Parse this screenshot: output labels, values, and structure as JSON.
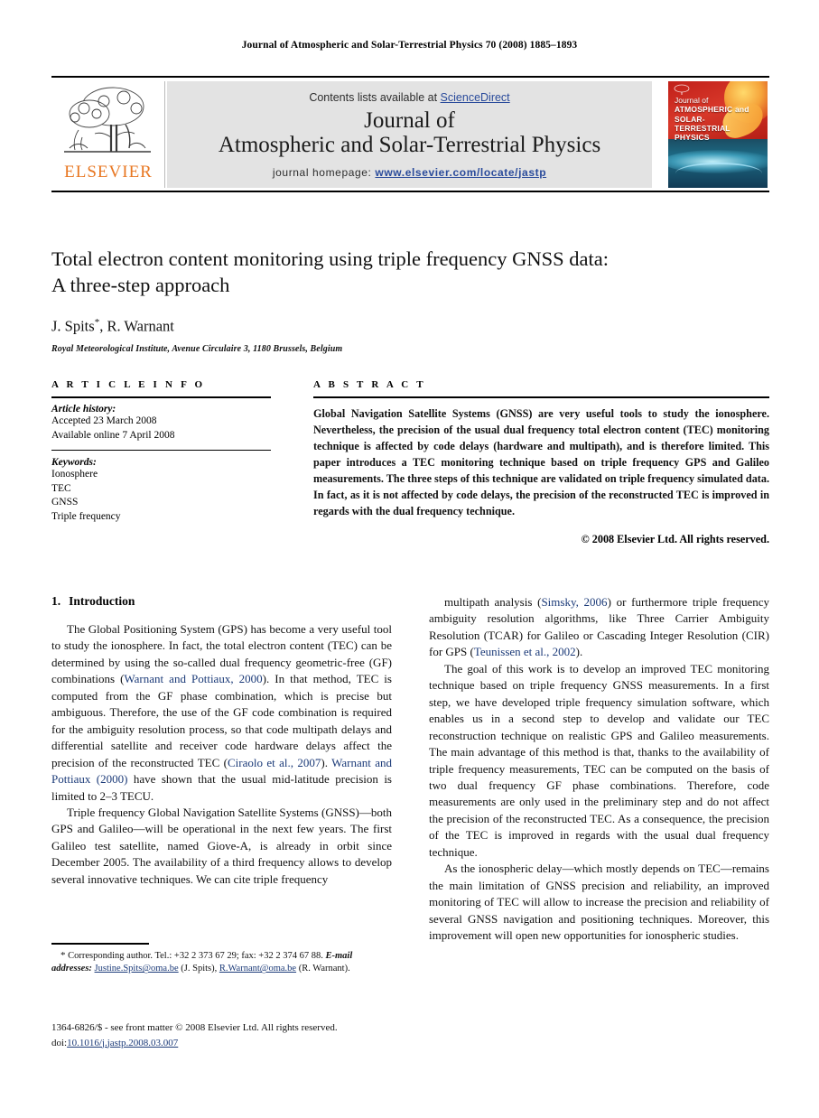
{
  "running_head": "Journal of Atmospheric and Solar-Terrestrial Physics 70 (2008) 1885–1893",
  "masthead": {
    "contents_prefix": "Contents lists available at ",
    "sciencedirect": "ScienceDirect",
    "journal_title_line1": "Journal of",
    "journal_title_line2": "Atmospheric and Solar-Terrestrial Physics",
    "homepage_label": "journal homepage: ",
    "homepage_url": "www.elsevier.com/locate/jastp",
    "publisher_wordmark": "ELSEVIER",
    "publisher_color": "#E87722",
    "link_color": "#2a4b9b",
    "panel_bg": "#e3e3e3",
    "cover": {
      "line1": "Journal of",
      "line2": "ATMOSPHERIC and",
      "line3": "SOLAR-TERRESTRIAL",
      "line4": "PHYSICS"
    }
  },
  "title_block": {
    "title_line1": "Total electron content monitoring using triple frequency GNSS data:",
    "title_line2": "A three-step approach",
    "authors": "J. Spits",
    "author_marker": "*",
    "authors_rest": ", R. Warnant",
    "affiliation": "Royal Meteorological Institute, Avenue Circulaire 3, 1180 Brussels, Belgium"
  },
  "article_info": {
    "heading": "A R T I C L E   I N F O",
    "history_label": "Article history:",
    "history_lines": [
      "Accepted 23 March 2008",
      "Available online 7 April 2008"
    ],
    "keywords_label": "Keywords:",
    "keywords": [
      "Ionosphere",
      "TEC",
      "GNSS",
      "Triple frequency"
    ]
  },
  "abstract": {
    "heading": "A B S T R A C T",
    "text": "Global Navigation Satellite Systems (GNSS) are very useful tools to study the ionosphere. Nevertheless, the precision of the usual dual frequency total electron content (TEC) monitoring technique is affected by code delays (hardware and multipath), and is therefore limited. This paper introduces a TEC monitoring technique based on triple frequency GPS and Galileo measurements. The three steps of this technique are validated on triple frequency simulated data. In fact, as it is not affected by code delays, the precision of the reconstructed TEC is improved in regards with the dual frequency technique.",
    "copyright": "© 2008 Elsevier Ltd. All rights reserved."
  },
  "body": {
    "section_number": "1.",
    "section_title": "Introduction",
    "left_paragraphs": [
      {
        "segments": [
          {
            "t": "The Global Positioning System (GPS) has become a very useful tool to study the ionosphere. In fact, the total electron content (TEC) can be determined by using the so-called dual frequency geometric-free (GF) combinations (",
            "cite": false
          },
          {
            "t": "Warnant and Pottiaux, 2000",
            "cite": true
          },
          {
            "t": "). In that method, TEC is computed from the GF phase combination, which is precise but ambiguous. Therefore, the use of the GF code combination is required for the ambiguity resolution process, so that code multipath delays and differential satellite and receiver code hardware delays affect the precision of the reconstructed TEC (",
            "cite": false
          },
          {
            "t": "Ciraolo et al., 2007",
            "cite": true
          },
          {
            "t": "). ",
            "cite": false
          },
          {
            "t": "Warnant and Pottiaux (2000)",
            "cite": true
          },
          {
            "t": " have shown that the usual mid-latitude precision is limited to 2–3 TECU.",
            "cite": false
          }
        ]
      },
      {
        "segments": [
          {
            "t": "Triple frequency Global Navigation Satellite Systems (GNSS)—both GPS and Galileo—will be operational in the next few years. The first Galileo test satellite, named Giove-A, is already in orbit since December 2005. The availability of a third frequency allows to develop several innovative techniques. We can cite triple frequency",
            "cite": false
          }
        ]
      }
    ],
    "right_paragraphs": [
      {
        "segments": [
          {
            "t": "multipath analysis (",
            "cite": false
          },
          {
            "t": "Simsky, 2006",
            "cite": true
          },
          {
            "t": ") or furthermore triple frequency ambiguity resolution algorithms, like Three Carrier Ambiguity Resolution (TCAR) for Galileo or Cascading Integer Resolution (CIR) for GPS (",
            "cite": false
          },
          {
            "t": "Teunissen et al., 2002",
            "cite": true
          },
          {
            "t": ").",
            "cite": false
          }
        ],
        "no_indent": false
      },
      {
        "segments": [
          {
            "t": "The goal of this work is to develop an improved TEC monitoring technique based on triple frequency GNSS measurements. In a first step, we have developed triple frequency simulation software, which enables us in a second step to develop and validate our TEC reconstruction technique on realistic GPS and Galileo measurements. The main advantage of this method is that, thanks to the availability of triple frequency measurements, TEC can be computed on the basis of two dual frequency GF phase combinations. Therefore, code measurements are only used in the preliminary step and do not affect the precision of the reconstructed TEC. As a consequence, the precision of the TEC is improved in regards with the usual dual frequency technique.",
            "cite": false
          }
        ]
      },
      {
        "segments": [
          {
            "t": "As the ionospheric delay—which mostly depends on TEC—remains the main limitation of GNSS precision and reliability, an improved monitoring of TEC will allow to increase the precision and reliability of several GNSS navigation and positioning techniques. Moreover, this improvement will open new opportunities for ionospheric studies.",
            "cite": false
          }
        ]
      }
    ]
  },
  "footnote": {
    "star": "*",
    "corresponding": " Corresponding author. Tel.: +32 2 373 67 29; fax: +32 2 374 67 88.",
    "email_label": "E-mail addresses:",
    "email1": "Justine.Spits@oma.be",
    "email1_name": " (J. Spits),",
    "email2": "R.Warnant@oma.be",
    "email2_name": " (R. Warnant)."
  },
  "imprint": {
    "line1": "1364-6826/$ - see front matter © 2008 Elsevier Ltd. All rights reserved.",
    "doi_label": "doi:",
    "doi": "10.1016/j.jastp.2008.03.007"
  }
}
